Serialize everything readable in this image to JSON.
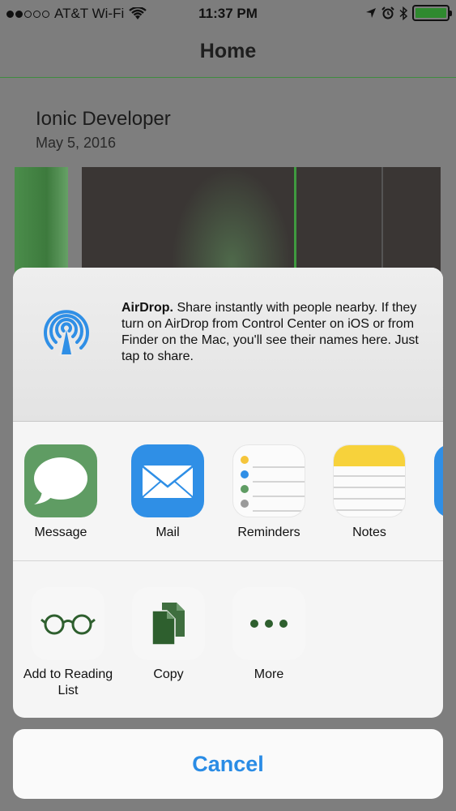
{
  "status_bar": {
    "carrier": "AT&T Wi-Fi",
    "time": "11:37 PM",
    "signal_bars_filled": 2,
    "signal_bars_total": 5,
    "battery_level": 1.0,
    "icons": [
      "wifi-icon",
      "location-icon",
      "alarm-icon",
      "bluetooth-icon",
      "battery-icon"
    ]
  },
  "nav": {
    "title": "Home"
  },
  "card": {
    "title": "Ionic Developer",
    "date": "May 5, 2016"
  },
  "share_sheet": {
    "airdrop": {
      "title": "AirDrop.",
      "text": "Share instantly with people nearby. If they turn on AirDrop from Control Center on iOS or from Finder on the Mac, you'll see their names here. Just tap to share."
    },
    "apps": [
      {
        "label": "Message",
        "icon": "message-icon"
      },
      {
        "label": "Mail",
        "icon": "mail-icon"
      },
      {
        "label": "Reminders",
        "icon": "reminders-icon"
      },
      {
        "label": "Notes",
        "icon": "notes-icon"
      }
    ],
    "actions": [
      {
        "label": "Add to Reading List",
        "icon": "glasses-icon"
      },
      {
        "label": "Copy",
        "icon": "copy-icon"
      },
      {
        "label": "More",
        "icon": "more-icon"
      }
    ]
  },
  "cancel_label": "Cancel",
  "colors": {
    "accent": "#2a8ce5",
    "status_green": "#2f8a2f",
    "message_green": "#5f9c63",
    "mail_blue": "#2f8fe6",
    "notes_yellow": "#f7d23b"
  }
}
